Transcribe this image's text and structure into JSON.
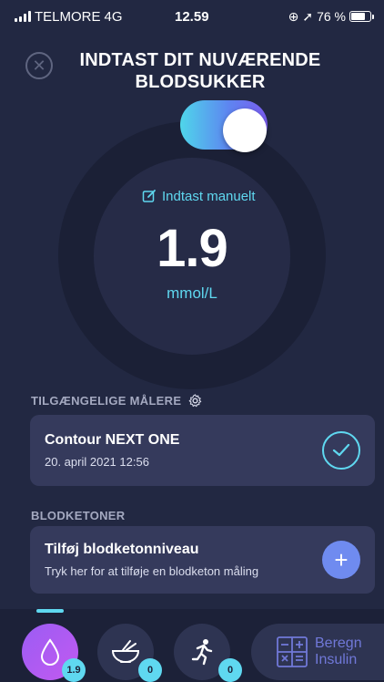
{
  "status_bar": {
    "carrier": "TELMORE",
    "network": "4G",
    "time": "12.59",
    "battery": "76 %",
    "battery_level": 0.76
  },
  "header": {
    "title": "INDTAST DIT NUVÆRENDE BLODSUKKER"
  },
  "reading": {
    "manual_entry_label": "Indtast manuelt",
    "value": "1.9",
    "unit": "mmol/L",
    "toggle_on": true
  },
  "meters": {
    "section_title": "TILGÆNGELIGE MÅLERE",
    "device_name": "Contour NEXT ONE",
    "device_date": "20. april 2021 12:56"
  },
  "ketones": {
    "section_title": "BLODKETONER",
    "add_title": "Tilføj blodketonniveau",
    "add_subtitle": "Tryk her for at tilføje en blodketon måling"
  },
  "bottom_nav": {
    "glucose_badge": "1.9",
    "meal_badge": "0",
    "activity_badge": "0",
    "calc_line1": "Beregn",
    "calc_line2": "Insulin"
  },
  "colors": {
    "background": "#222842",
    "accent": "#5fd8f0",
    "card": "#353a5c",
    "purple": "#9b5cf4"
  }
}
